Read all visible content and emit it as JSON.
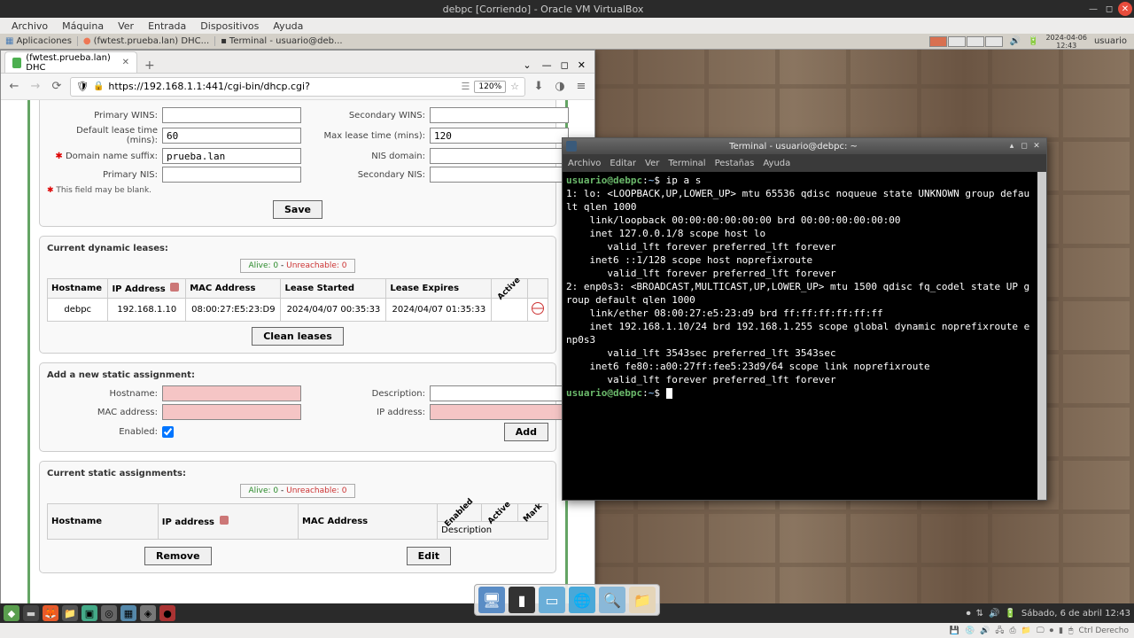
{
  "vbox": {
    "title": "debpc [Corriendo] - Oracle VM VirtualBox",
    "menu": [
      "Archivo",
      "Máquina",
      "Ver",
      "Entrada",
      "Dispositivos",
      "Ayuda"
    ],
    "status_key": "Ctrl Derecho"
  },
  "guest_panel": {
    "apps": "Aplicaciones",
    "tasks": [
      "(fwtest.prueba.lan) DHC...",
      "Terminal - usuario@deb..."
    ],
    "clock": "2024-04-06\n12:43",
    "user": "usuario"
  },
  "browser": {
    "tab_title": "(fwtest.prueba.lan) DHC",
    "url": "https://192.168.1.1:441/cgi-bin/dhcp.cgi?",
    "zoom": "120%"
  },
  "dhcp": {
    "labels": {
      "primary_wins": "Primary WINS:",
      "secondary_wins": "Secondary WINS:",
      "default_lease": "Default lease time (mins):",
      "max_lease": "Max lease time (mins):",
      "domain_suffix": "Domain name suffix:",
      "nis_domain": "NIS domain:",
      "primary_nis": "Primary NIS:",
      "secondary_nis": "Secondary NIS:",
      "field_blank": "This field may be blank.",
      "save": "Save",
      "dynamic_leases": "Current dynamic leases:",
      "clean_leases": "Clean leases",
      "static_add": "Add a new static assignment:",
      "hostname": "Hostname:",
      "description": "Description:",
      "mac": "MAC address:",
      "ip": "IP address:",
      "enabled": "Enabled:",
      "add": "Add",
      "static_current": "Current static assignments:",
      "remove": "Remove",
      "edit": "Edit"
    },
    "values": {
      "default_lease": "60",
      "max_lease": "120",
      "domain_suffix": "prueba.lan"
    },
    "status_alive": "Alive: 0",
    "status_unreach": "Unreachable: 0",
    "lease_headers": [
      "Hostname",
      "IP Address",
      "MAC Address",
      "Lease Started",
      "Lease Expires",
      "Active"
    ],
    "lease_row": {
      "hostname": "debpc",
      "ip": "192.168.1.10",
      "mac": "08:00:27:E5:23:D9",
      "started": "2024/04/07 00:35:33",
      "expires": "2024/04/07 01:35:33"
    },
    "static_headers": [
      "Hostname",
      "IP address",
      "MAC Address",
      "Enabled",
      "Active",
      "Mark",
      "Description"
    ]
  },
  "terminal": {
    "title": "Terminal - usuario@debpc: ~",
    "menu": [
      "Archivo",
      "Editar",
      "Ver",
      "Terminal",
      "Pestañas",
      "Ayuda"
    ],
    "prompt_user": "usuario@debpc",
    "prompt_path": "~",
    "command": "ip a s",
    "output": "1: lo: <LOOPBACK,UP,LOWER_UP> mtu 65536 qdisc noqueue state UNKNOWN group default qlen 1000\n    link/loopback 00:00:00:00:00:00 brd 00:00:00:00:00:00\n    inet 127.0.0.1/8 scope host lo\n       valid_lft forever preferred_lft forever\n    inet6 ::1/128 scope host noprefixroute\n       valid_lft forever preferred_lft forever\n2: enp0s3: <BROADCAST,MULTICAST,UP,LOWER_UP> mtu 1500 qdisc fq_codel state UP group default qlen 1000\n    link/ether 08:00:27:e5:23:d9 brd ff:ff:ff:ff:ff:ff\n    inet 192.168.1.10/24 brd 192.168.1.255 scope global dynamic noprefixroute enp0s3\n       valid_lft 3543sec preferred_lft 3543sec\n    inet6 fe80::a00:27ff:fee5:23d9/64 scope link noprefixroute\n       valid_lft forever preferred_lft forever"
  },
  "guest_taskbar": {
    "date": "Sábado, 6 de abril  12:43"
  }
}
